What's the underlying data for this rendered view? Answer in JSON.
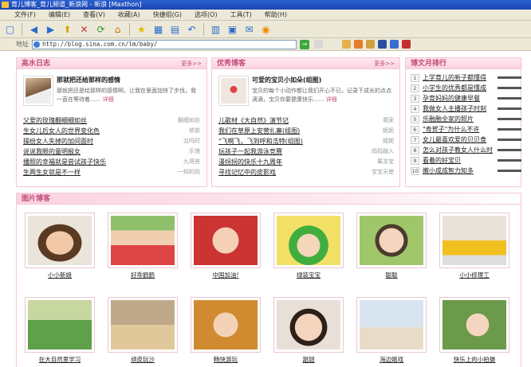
{
  "window": {
    "title": "育儿博客_育儿频道_新浪网 - 新浪 [Maxthon]"
  },
  "menu": [
    "文件(F)",
    "编辑(E)",
    "查看(V)",
    "收藏(A)",
    "快捷组(G)",
    "选项(O)",
    "工具(T)",
    "帮助(H)"
  ],
  "address": {
    "label": "地址",
    "url": "http://blog.sina.com.cn/lm/baby/"
  },
  "panels": {
    "diary": {
      "title": "高水日志",
      "more": "更多>>",
      "feature": {
        "title": "那就把还给那样的感情",
        "desc": "那就把还是给那样的感情啊，让我在里面加快了步伐，我一直在等待着......",
        "detail": "详细"
      },
      "items": [
        {
          "title": "父爱的玫瑰翻细细如丝",
          "author": "翻细如丝"
        },
        {
          "title": "生女儿后女人的世界变化色",
          "author": "依依"
        },
        {
          "title": "操纷女人失掉的加间面时",
          "author": "北吗时"
        },
        {
          "title": "说说我眼的童明报女",
          "author": "乐馆"
        },
        {
          "title": "播照的幸福就是尝试孩子快乐",
          "author": "九哥爸"
        },
        {
          "title": "生两生女就是不一样",
          "author": "一知的妈"
        }
      ]
    },
    "blogger": {
      "title": "优秀博客",
      "more": "更多>>",
      "feature": {
        "title": "可爱的宝贝小如朵(组图)",
        "desc": "宝贝的每个小动作都让我们开心不已，记录下成长的点点滴滴，宝贝你要健康快乐......",
        "detail": "详细"
      },
      "items": [
        {
          "title": "儿歌材《大自然》演节记",
          "author": "我家"
        },
        {
          "title": "我们在草原上安营扎寨(组图)",
          "author": "妮妮"
        },
        {
          "title": "\"飞啊飞，飞到呼和浩特(组图)",
          "author": "妮妮"
        },
        {
          "title": "玩孩子一起我游泳竞赛",
          "author": "妈妈融入"
        },
        {
          "title": "漫拐拐的快乐十九周年",
          "author": "果冻宝"
        },
        {
          "title": "寻找记忆中的皮影戏",
          "author": "宝宝天使"
        }
      ]
    },
    "ranking": {
      "title": "博文月排行",
      "items": [
        {
          "num": "1",
          "title": "上学育儿的新子都懂得"
        },
        {
          "num": "2",
          "title": "小学生的优秀都是懂成"
        },
        {
          "num": "3",
          "title": "孕育妈妈的健康早餐"
        },
        {
          "num": "4",
          "title": "我做女人主播孩子时刻"
        },
        {
          "num": "5",
          "title": "乐融融全家的照片"
        },
        {
          "num": "6",
          "title": "\"寿贺子\"为什么不许"
        },
        {
          "num": "7",
          "title": "女儿最喜欢爱的贝贝食"
        },
        {
          "num": "8",
          "title": "怎么对孩子教女人什么时"
        },
        {
          "num": "9",
          "title": "看着的好宝贝"
        },
        {
          "num": "10",
          "title": "嫩小成成智力知多"
        }
      ]
    },
    "photos": {
      "title": "图片博客",
      "row1": [
        {
          "caption": "小小新娘"
        },
        {
          "caption": "好乖鹤鹤"
        },
        {
          "caption": "中国加油!"
        },
        {
          "caption": "绿装宝宝"
        },
        {
          "caption": "聪聪"
        },
        {
          "caption": "小小修理工"
        }
      ],
      "row2": [
        {
          "caption": "在大自然里学习"
        },
        {
          "caption": "顽皮玩沙"
        },
        {
          "caption": "畅快游玩"
        },
        {
          "caption": "甜甜"
        },
        {
          "caption": "海边嬉戏"
        },
        {
          "caption": "快乐上的小拍摄"
        }
      ]
    }
  },
  "colors": {
    "accent": "#c24a7a",
    "panel_border": "#f3c7d6",
    "panel_head": "#fbd3e0",
    "chrome": "#ece9d8"
  }
}
